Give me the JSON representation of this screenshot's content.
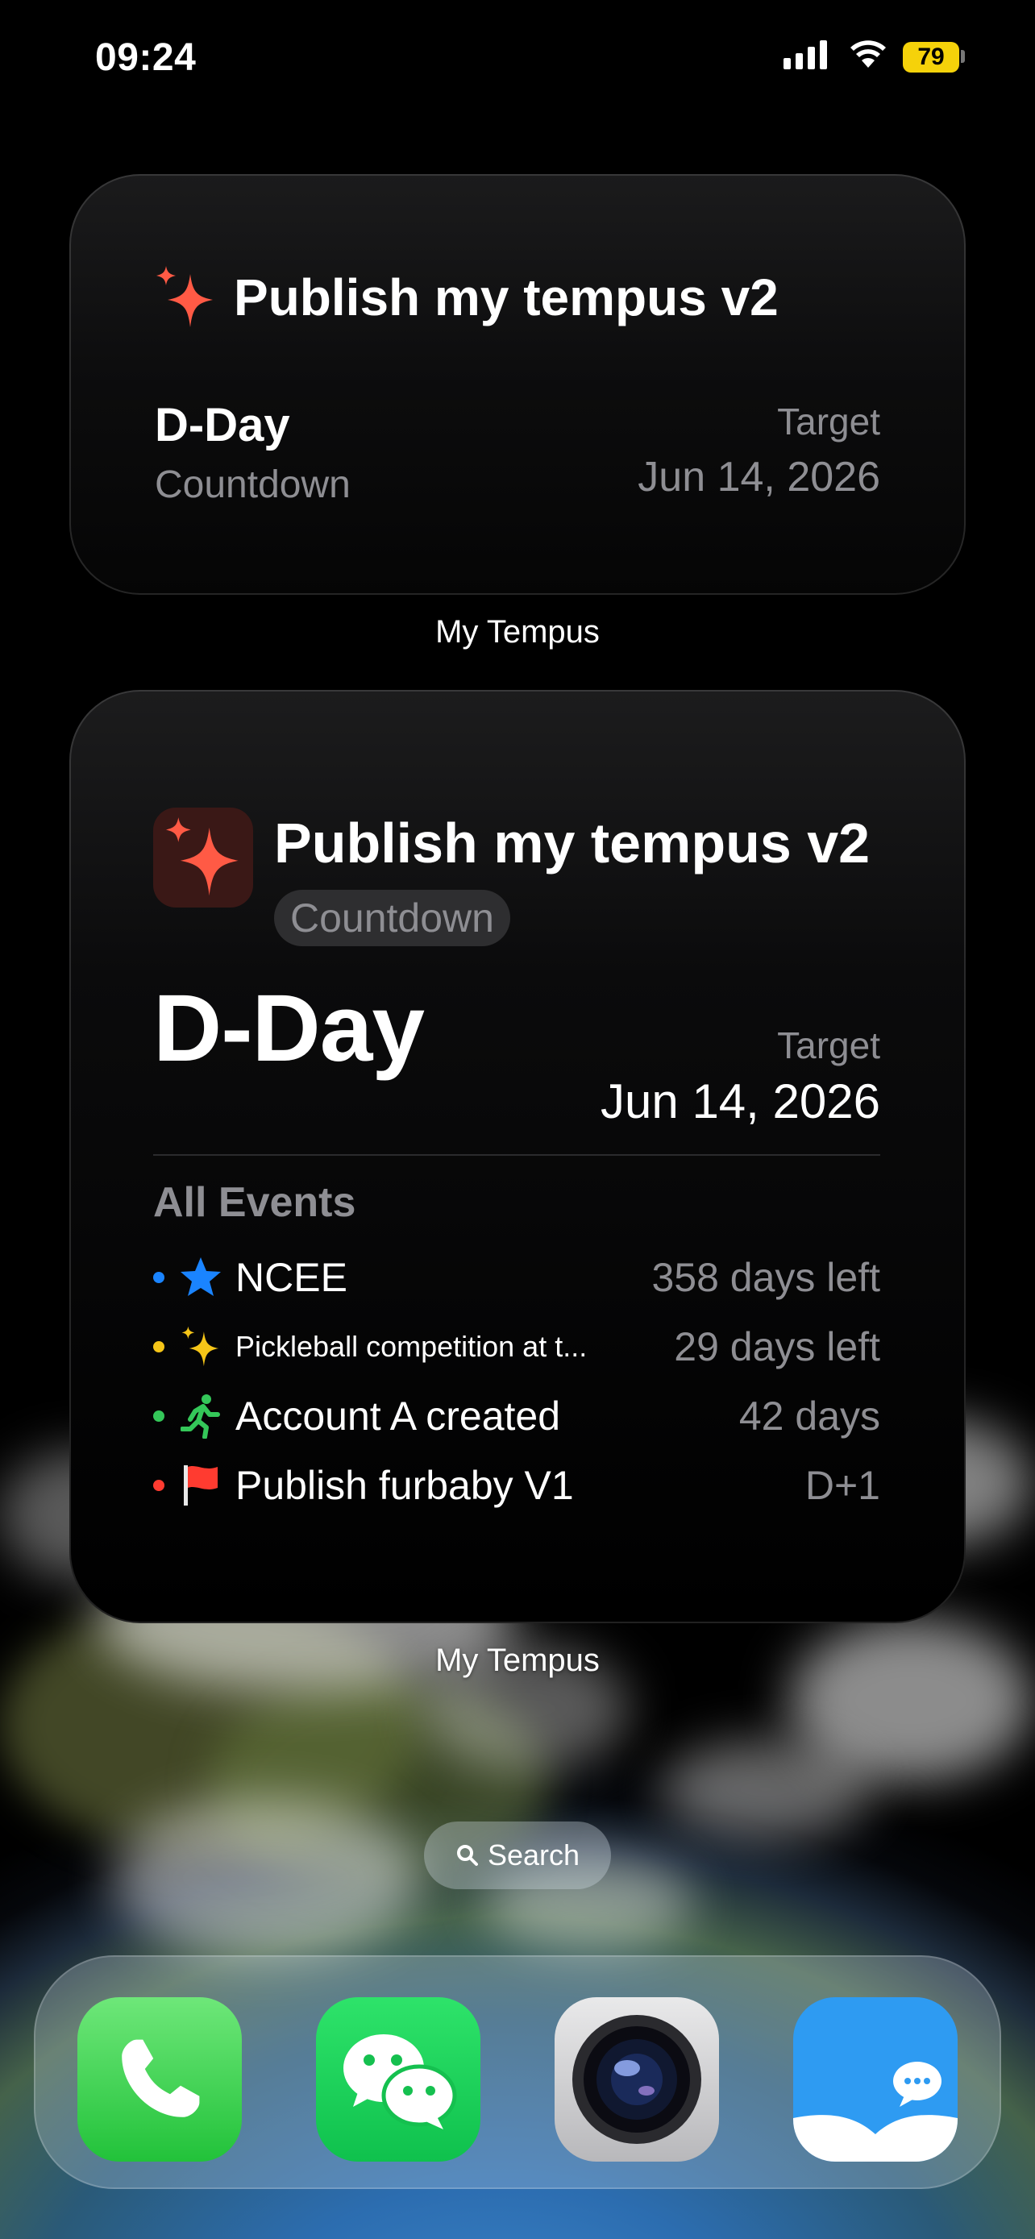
{
  "status_bar": {
    "time": "09:24",
    "battery_level": "79",
    "battery_color": "#f5d20a"
  },
  "widget_small": {
    "title": "Publish my tempus v2",
    "icon": "sparkles-icon",
    "value": "D-Day",
    "subtitle": "Countdown",
    "target_label": "Target",
    "target_date": "Jun 14, 2026",
    "caption": "My Tempus"
  },
  "widget_large": {
    "title": "Publish my tempus v2",
    "icon": "sparkles-icon",
    "badge": "Countdown",
    "value": "D-Day",
    "target_label": "Target",
    "target_date": "Jun 14, 2026",
    "events_header": "All Events",
    "caption": "My Tempus",
    "events": [
      {
        "dot_color": "#1a84ff",
        "icon": "star-icon",
        "name": "NCEE",
        "days": "358 days left"
      },
      {
        "dot_color": "#f5c518",
        "icon": "sparkles-icon",
        "name": "Pickleball competition at t...",
        "days": "29 days left"
      },
      {
        "dot_color": "#34c759",
        "icon": "runner-icon",
        "name": "Account A created",
        "days": "42 days"
      },
      {
        "dot_color": "#ff3b30",
        "icon": "red-flag-icon",
        "name": "Publish furbaby V1",
        "days": "D+1"
      }
    ]
  },
  "search": {
    "label": "Search"
  },
  "dock": {
    "apps": [
      {
        "icon": "phone-icon"
      },
      {
        "icon": "wechat-icon"
      },
      {
        "icon": "camera-icon"
      },
      {
        "icon": "messenger-icon"
      }
    ]
  },
  "accent_colors": {
    "sparkle": "#ff5a45",
    "secondary_text": "#8e8e93"
  }
}
